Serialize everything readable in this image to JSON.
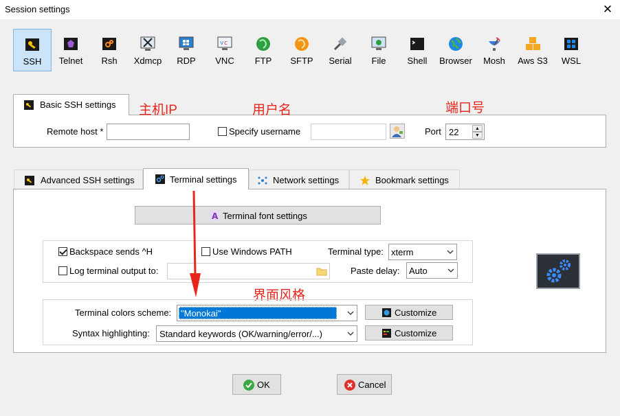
{
  "window": {
    "title": "Session settings",
    "close_icon": "close-icon"
  },
  "toolbar": [
    {
      "label": "SSH",
      "icon": "ssh-key-icon"
    },
    {
      "label": "Telnet",
      "icon": "telnet-icon"
    },
    {
      "label": "Rsh",
      "icon": "rsh-icon"
    },
    {
      "label": "Xdmcp",
      "icon": "xdmcp-icon"
    },
    {
      "label": "RDP",
      "icon": "rdp-icon"
    },
    {
      "label": "VNC",
      "icon": "vnc-icon"
    },
    {
      "label": "FTP",
      "icon": "ftp-icon"
    },
    {
      "label": "SFTP",
      "icon": "sftp-icon"
    },
    {
      "label": "Serial",
      "icon": "serial-icon"
    },
    {
      "label": "File",
      "icon": "file-icon"
    },
    {
      "label": "Shell",
      "icon": "shell-icon"
    },
    {
      "label": "Browser",
      "icon": "browser-icon"
    },
    {
      "label": "Mosh",
      "icon": "mosh-icon"
    },
    {
      "label": "Aws S3",
      "icon": "aws-s3-icon"
    },
    {
      "label": "WSL",
      "icon": "wsl-icon"
    }
  ],
  "basic": {
    "tab_label": "Basic SSH settings",
    "remote_host_label": "Remote host *",
    "remote_host_value": "",
    "specify_username_label": "Specify username",
    "username_value": "",
    "port_label": "Port",
    "port_value": "22"
  },
  "annotations": {
    "host_ip": "主机IP",
    "username": "用户名",
    "port": "端口号",
    "ui_style": "界面风格"
  },
  "adv_tabs": [
    {
      "label": "Advanced SSH settings"
    },
    {
      "label": "Terminal settings"
    },
    {
      "label": "Network settings"
    },
    {
      "label": "Bookmark settings"
    }
  ],
  "terminal": {
    "font_button": "Terminal font settings",
    "backspace_label": "Backspace sends ^H",
    "windows_path_label": "Use Windows PATH",
    "terminal_type_label": "Terminal type:",
    "terminal_type_value": "xterm",
    "log_output_label": "Log terminal output to:",
    "paste_delay_label": "Paste delay:",
    "paste_delay_value": "Auto",
    "colors_label": "Terminal colors scheme:",
    "colors_value": "\"Monokai\"",
    "syntax_label": "Syntax highlighting:",
    "syntax_value": "Standard keywords (OK/warning/error/...)",
    "customize_1": "Customize",
    "customize_2": "Customize"
  },
  "buttons": {
    "ok": "OK",
    "cancel": "Cancel"
  },
  "colors": {
    "accent_red": "#e8261c",
    "selection_blue": "#0078d7"
  }
}
